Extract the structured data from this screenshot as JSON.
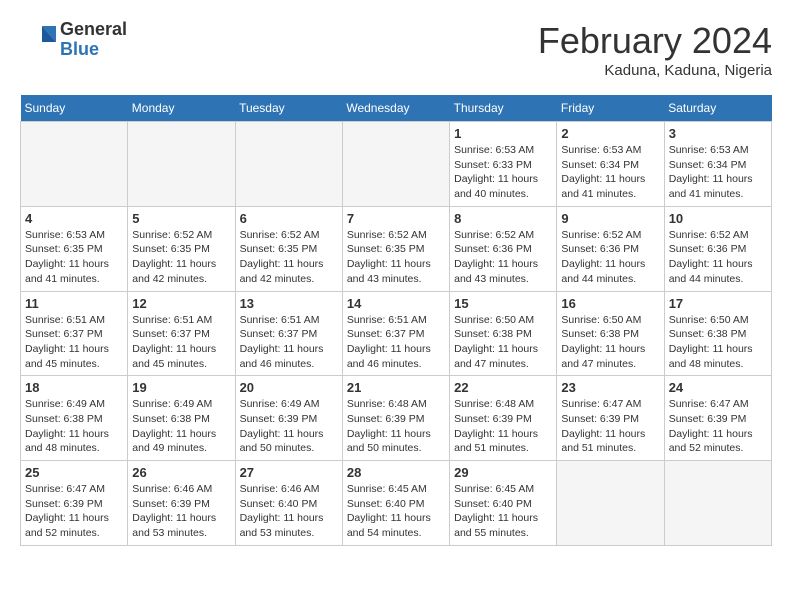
{
  "header": {
    "logo_general": "General",
    "logo_blue": "Blue",
    "title": "February 2024",
    "location": "Kaduna, Kaduna, Nigeria"
  },
  "columns": [
    "Sunday",
    "Monday",
    "Tuesday",
    "Wednesday",
    "Thursday",
    "Friday",
    "Saturday"
  ],
  "weeks": [
    {
      "days": [
        {
          "num": "",
          "empty": true
        },
        {
          "num": "",
          "empty": true
        },
        {
          "num": "",
          "empty": true
        },
        {
          "num": "",
          "empty": true
        },
        {
          "num": "1",
          "sunrise": "6:53 AM",
          "sunset": "6:33 PM",
          "daylight": "11 hours and 40 minutes."
        },
        {
          "num": "2",
          "sunrise": "6:53 AM",
          "sunset": "6:34 PM",
          "daylight": "11 hours and 41 minutes."
        },
        {
          "num": "3",
          "sunrise": "6:53 AM",
          "sunset": "6:34 PM",
          "daylight": "11 hours and 41 minutes."
        }
      ]
    },
    {
      "shaded": true,
      "days": [
        {
          "num": "4",
          "sunrise": "6:53 AM",
          "sunset": "6:35 PM",
          "daylight": "11 hours and 41 minutes."
        },
        {
          "num": "5",
          "sunrise": "6:52 AM",
          "sunset": "6:35 PM",
          "daylight": "11 hours and 42 minutes."
        },
        {
          "num": "6",
          "sunrise": "6:52 AM",
          "sunset": "6:35 PM",
          "daylight": "11 hours and 42 minutes."
        },
        {
          "num": "7",
          "sunrise": "6:52 AM",
          "sunset": "6:35 PM",
          "daylight": "11 hours and 43 minutes."
        },
        {
          "num": "8",
          "sunrise": "6:52 AM",
          "sunset": "6:36 PM",
          "daylight": "11 hours and 43 minutes."
        },
        {
          "num": "9",
          "sunrise": "6:52 AM",
          "sunset": "6:36 PM",
          "daylight": "11 hours and 44 minutes."
        },
        {
          "num": "10",
          "sunrise": "6:52 AM",
          "sunset": "6:36 PM",
          "daylight": "11 hours and 44 minutes."
        }
      ]
    },
    {
      "days": [
        {
          "num": "11",
          "sunrise": "6:51 AM",
          "sunset": "6:37 PM",
          "daylight": "11 hours and 45 minutes."
        },
        {
          "num": "12",
          "sunrise": "6:51 AM",
          "sunset": "6:37 PM",
          "daylight": "11 hours and 45 minutes."
        },
        {
          "num": "13",
          "sunrise": "6:51 AM",
          "sunset": "6:37 PM",
          "daylight": "11 hours and 46 minutes."
        },
        {
          "num": "14",
          "sunrise": "6:51 AM",
          "sunset": "6:37 PM",
          "daylight": "11 hours and 46 minutes."
        },
        {
          "num": "15",
          "sunrise": "6:50 AM",
          "sunset": "6:38 PM",
          "daylight": "11 hours and 47 minutes."
        },
        {
          "num": "16",
          "sunrise": "6:50 AM",
          "sunset": "6:38 PM",
          "daylight": "11 hours and 47 minutes."
        },
        {
          "num": "17",
          "sunrise": "6:50 AM",
          "sunset": "6:38 PM",
          "daylight": "11 hours and 48 minutes."
        }
      ]
    },
    {
      "shaded": true,
      "days": [
        {
          "num": "18",
          "sunrise": "6:49 AM",
          "sunset": "6:38 PM",
          "daylight": "11 hours and 48 minutes."
        },
        {
          "num": "19",
          "sunrise": "6:49 AM",
          "sunset": "6:38 PM",
          "daylight": "11 hours and 49 minutes."
        },
        {
          "num": "20",
          "sunrise": "6:49 AM",
          "sunset": "6:39 PM",
          "daylight": "11 hours and 50 minutes."
        },
        {
          "num": "21",
          "sunrise": "6:48 AM",
          "sunset": "6:39 PM",
          "daylight": "11 hours and 50 minutes."
        },
        {
          "num": "22",
          "sunrise": "6:48 AM",
          "sunset": "6:39 PM",
          "daylight": "11 hours and 51 minutes."
        },
        {
          "num": "23",
          "sunrise": "6:47 AM",
          "sunset": "6:39 PM",
          "daylight": "11 hours and 51 minutes."
        },
        {
          "num": "24",
          "sunrise": "6:47 AM",
          "sunset": "6:39 PM",
          "daylight": "11 hours and 52 minutes."
        }
      ]
    },
    {
      "days": [
        {
          "num": "25",
          "sunrise": "6:47 AM",
          "sunset": "6:39 PM",
          "daylight": "11 hours and 52 minutes."
        },
        {
          "num": "26",
          "sunrise": "6:46 AM",
          "sunset": "6:39 PM",
          "daylight": "11 hours and 53 minutes."
        },
        {
          "num": "27",
          "sunrise": "6:46 AM",
          "sunset": "6:40 PM",
          "daylight": "11 hours and 53 minutes."
        },
        {
          "num": "28",
          "sunrise": "6:45 AM",
          "sunset": "6:40 PM",
          "daylight": "11 hours and 54 minutes."
        },
        {
          "num": "29",
          "sunrise": "6:45 AM",
          "sunset": "6:40 PM",
          "daylight": "11 hours and 55 minutes."
        },
        {
          "num": "",
          "empty": true
        },
        {
          "num": "",
          "empty": true
        }
      ]
    }
  ]
}
